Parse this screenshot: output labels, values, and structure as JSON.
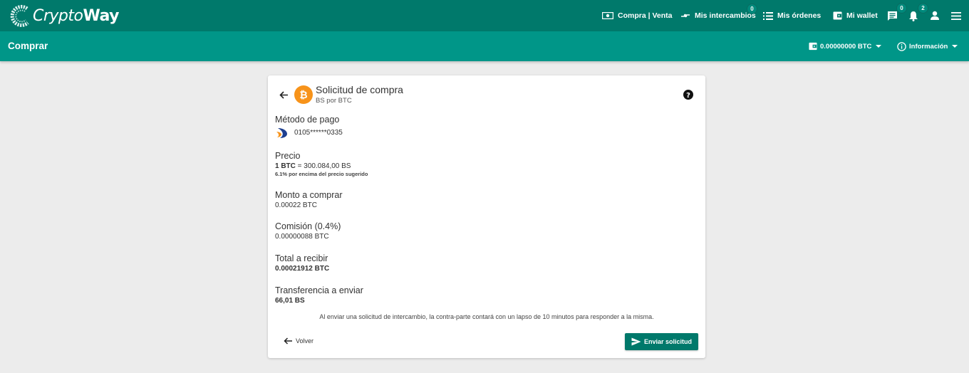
{
  "brand": {
    "name_part1": "Crypto",
    "name_part2": "Way"
  },
  "topnav": {
    "buy_sell": "Compra | Venta",
    "exchanges": "Mis intercambios",
    "exchanges_badge": "0",
    "orders": "Mis órdenes",
    "wallet": "Mi wallet",
    "messages_badge": "0",
    "notifications_badge": "2"
  },
  "subbar": {
    "title": "Comprar",
    "balance": "0.00000000 BTC",
    "info": "Información"
  },
  "card": {
    "title": "Solicitud de compra",
    "subtitle": "BS por BTC",
    "payment_label": "Método de pago",
    "payment_account": "0105******0335",
    "price_label": "Precio",
    "price_btc": "1 BTC",
    "price_rest": " = 300.084,00 BS",
    "price_note": "6.1% por encima del precio sugerido",
    "amount_label": "Monto a comprar",
    "amount_value": "0.00022 BTC",
    "fee_label": "Comisión (0.4%)",
    "fee_value": "0.00000088 BTC",
    "total_label": "Total a recibir",
    "total_value": "0.00021912 BTC",
    "transfer_label": "Transferencia a enviar",
    "transfer_value": "66,01 BS",
    "notice": "Al enviar una solicitud de intercambio, la contra-parte contará con un lapso de 10 minutos para responder a la misma.",
    "back_label": "Volver",
    "send_label": "Enviar solicitud"
  },
  "colors": {
    "topbar": "#00796b",
    "subbar": "#009688",
    "bitcoin": "#f7931a",
    "button": "#00796b"
  },
  "icons": {
    "logo": "cryptoway-logo",
    "buy_sell": "cash-icon",
    "exchanges": "swap-arrows-icon",
    "orders": "list-icon",
    "wallet": "wallet-icon",
    "messages": "chat-icon",
    "notifications": "bell-icon",
    "profile": "person-icon",
    "menu": "hamburger-icon",
    "info": "info-icon",
    "help": "help-circle-icon",
    "currency": "bitcoin-icon",
    "bank": "bank-logo",
    "back": "arrow-left-icon",
    "send": "send-icon"
  }
}
